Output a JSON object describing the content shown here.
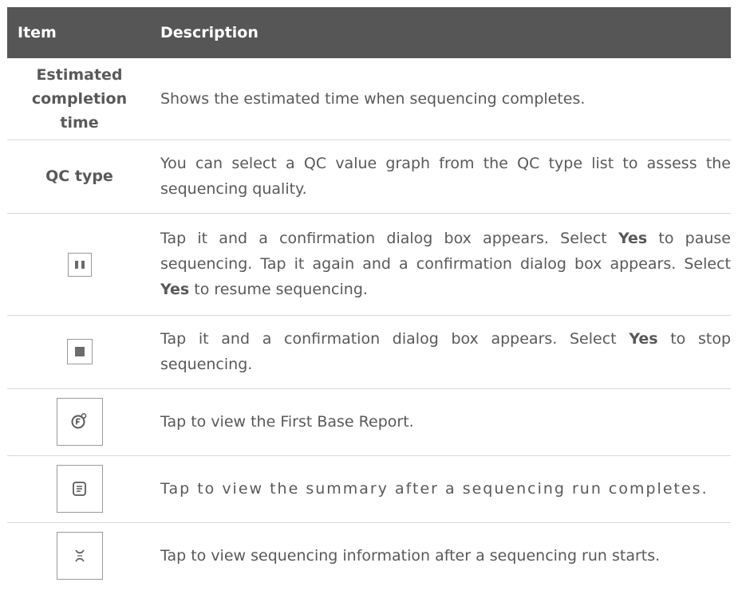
{
  "header": {
    "item": "Item",
    "description": "Description"
  },
  "rows": [
    {
      "item": "Estimated completion time",
      "description": "Shows the estimated time when sequencing completes."
    },
    {
      "item": "QC type",
      "description": "You can select a QC value graph from the QC type list to assess the sequencing quality."
    },
    {
      "icon": "pause-icon",
      "d1": "Tap it and a confirmation dialog box appears. Select ",
      "k1": "Yes",
      "d2": " to pause sequencing. Tap it again and a confirmation dialog box appears. Select ",
      "k2": "Yes",
      "d3": " to resume sequencing."
    },
    {
      "icon": "stop-icon",
      "d1": "Tap it and a confirmation dialog box appears. Select ",
      "k1": "Yes",
      "d2": " to stop sequencing."
    },
    {
      "icon": "first-base-report-icon",
      "description": "Tap to view the First Base Report."
    },
    {
      "icon": "summary-document-icon",
      "description": "Tap to view the summary after a sequencing run completes."
    },
    {
      "icon": "dna-icon",
      "description": "Tap to view sequencing information after a sequencing run starts."
    }
  ],
  "colors": {
    "header_bg": "#565656",
    "header_text": "#ffffff",
    "body_text": "#595959",
    "divider": "#d9d9d9",
    "icon_border": "#9a9a9a"
  }
}
